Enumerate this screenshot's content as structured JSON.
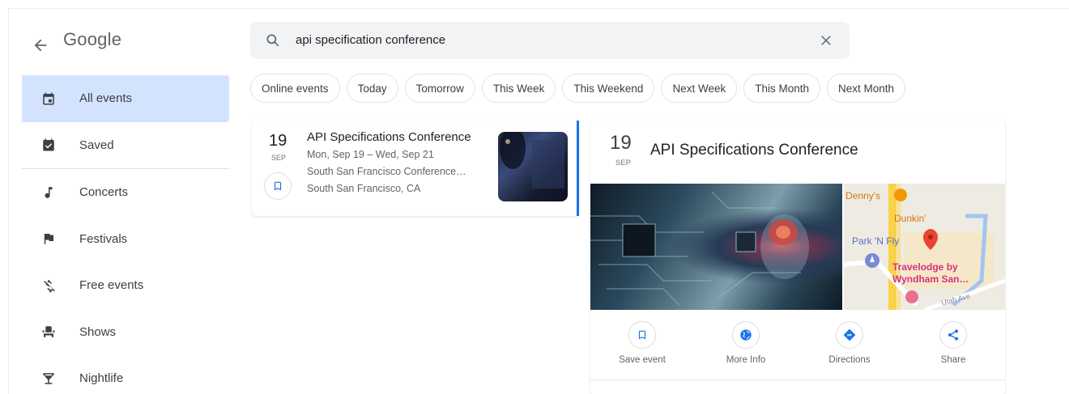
{
  "header": {
    "logo": "Google",
    "search_value": "api specification conference"
  },
  "sidebar": {
    "items": [
      {
        "label": "All events",
        "icon": "calendar-icon",
        "active": true
      },
      {
        "label": "Saved",
        "icon": "saved-calendar-icon"
      },
      {
        "label": "Concerts",
        "icon": "music-note-icon"
      },
      {
        "label": "Festivals",
        "icon": "flag-icon"
      },
      {
        "label": "Free events",
        "icon": "no-money-icon"
      },
      {
        "label": "Shows",
        "icon": "theater-seat-icon"
      },
      {
        "label": "Nightlife",
        "icon": "cocktail-icon"
      }
    ]
  },
  "filters": [
    "Online events",
    "Today",
    "Tomorrow",
    "This Week",
    "This Weekend",
    "Next Week",
    "This Month",
    "Next Month"
  ],
  "result": {
    "day": "19",
    "month": "SEP",
    "title": "API Specifications Conference",
    "dates": "Mon, Sep 19 – Wed, Sep 21",
    "venue": "South San Francisco Conference…",
    "city": "South San Francisco, CA"
  },
  "detail": {
    "day": "19",
    "month": "SEP",
    "title": "API Specifications Conference",
    "map_labels": [
      "Denny's",
      "Dunkin'",
      "Park 'N Fly",
      "Travelodge by",
      "Wyndham San…",
      "Utah Ave"
    ],
    "actions": [
      "Save event",
      "More Info",
      "Directions",
      "Share"
    ]
  },
  "colors": {
    "accent": "#1a73e8",
    "active_bg": "#d3e3fd",
    "map_pin": "#ea4335",
    "poi_orange": "#f29900"
  }
}
